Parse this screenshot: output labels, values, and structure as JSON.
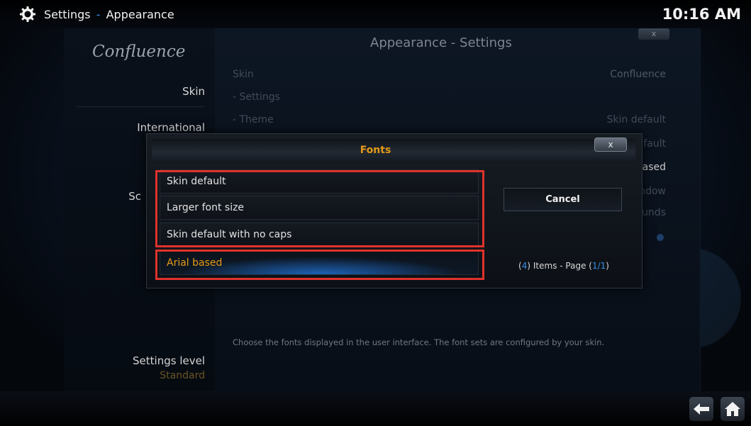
{
  "header": {
    "app_section": "Settings",
    "separator": "-",
    "page": "Appearance",
    "time": "10:16 AM"
  },
  "sidebar": {
    "logo": "Confluence",
    "items": [
      "Skin",
      "International",
      "Sc"
    ],
    "settings_level_label": "Settings level",
    "settings_level_value": "Standard"
  },
  "main": {
    "title": "Appearance - Settings",
    "close_label": "x",
    "rows_left": [
      "Skin",
      "- Settings",
      "- Theme"
    ],
    "rows_right": [
      "Confluence",
      "Skin default",
      "fault",
      "ased",
      "ndow",
      "unds"
    ],
    "description": "Choose the fonts displayed in the user interface. The font sets are configured by your skin."
  },
  "dialog": {
    "title": "Fonts",
    "close_label": "x",
    "options": [
      "Skin default",
      "Larger font size",
      "Skin default with no caps",
      "Arial based"
    ],
    "selected_index": 3,
    "cancel_label": "Cancel",
    "items_info": {
      "open": "(",
      "count": "4",
      "middle": ") Items - Page (",
      "page": "1/1",
      "close": ")"
    }
  },
  "colors": {
    "accent_orange": "#e39a18",
    "accent_blue": "#3b8ee4",
    "highlight_red": "#e0322c"
  },
  "icons": [
    "gear-icon",
    "back-arrow-icon",
    "home-icon"
  ]
}
